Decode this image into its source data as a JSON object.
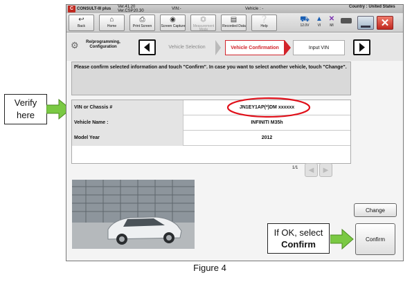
{
  "app": {
    "name": "CONSULT-III plus",
    "version_line1": "Ver.41.20",
    "version_line2": "Ver.CSP20.30",
    "vin_label": "VIN:-",
    "vehicle_label": "Vehicle : -",
    "country_label": "Country : United States"
  },
  "toolbar": {
    "back": "Back",
    "home": "Home",
    "print_screen": "Print Screen",
    "screen_capture": "Screen Capture",
    "measurement_mode": "Measurement Mode",
    "recorded_data": "Recorded Data",
    "help": "Help",
    "voltage": "12.0V",
    "vi": "VI",
    "mi": "MI"
  },
  "breadcrumb": {
    "section": "Re/programming, Configuration",
    "steps": [
      "Vehicle Selection",
      "Vehicle Confirmation",
      "Input VIN"
    ],
    "active_index": 1
  },
  "message": "Please confirm selected information and touch \"Confirm\". In case you want to select another vehicle, touch \"Change\".",
  "table": {
    "rows": [
      {
        "label": "VIN or Chassis #",
        "value": "JN1EY1AP(*)DM xxxxxx"
      },
      {
        "label": "Vehicle Name :",
        "value": "INFINITI M35h"
      },
      {
        "label": "Model Year",
        "value": "2012"
      }
    ],
    "page": "1/1"
  },
  "buttons": {
    "change": "Change",
    "confirm": "Confirm"
  },
  "annotations": {
    "verify_line1": "Verify",
    "verify_line2": "here",
    "ok_line1": "If OK, select",
    "ok_line2": "Confirm",
    "figure": "Figure 4"
  },
  "colors": {
    "accent_red": "#d2232a",
    "arrow_green": "#7ac943",
    "highlight_ellipse": "#e0101a"
  }
}
